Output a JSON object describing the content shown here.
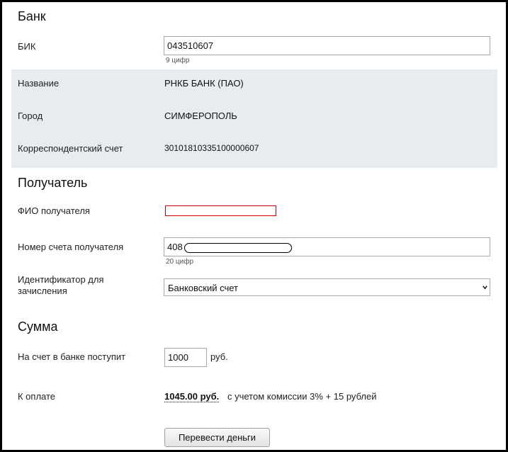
{
  "bank": {
    "title": "Банк",
    "bik_label": "БИК",
    "bik_value": "043510607",
    "bik_hint": "9 цифр",
    "name_label": "Название",
    "name_value": "РНКБ БАНК (ПАО)",
    "city_label": "Город",
    "city_value": "СИМФЕРОПОЛЬ",
    "corr_label": "Корреспондентский счет",
    "corr_value": "30101810335100000607"
  },
  "recipient": {
    "title": "Получатель",
    "fio_label": "ФИО получателя",
    "fio_value": "",
    "account_label": "Номер счета получателя",
    "account_prefix": "408",
    "account_hint": "20 цифр",
    "identifier_label_line1": "Идентификатор для",
    "identifier_label_line2": "зачисления",
    "identifier_selected": "Банковский счет"
  },
  "sum": {
    "title": "Сумма",
    "received_label": "На счет в банке поступит",
    "received_value": "1000",
    "currency": "руб.",
    "to_pay_label": "К оплате",
    "to_pay_value": "1045.00 руб.",
    "to_pay_note": "с учетом комиссии 3% + 15 рублей"
  },
  "actions": {
    "submit_label": "Перевести деньги"
  },
  "colors": {
    "band": "#e9ecef",
    "error_border": "#cc0000"
  }
}
